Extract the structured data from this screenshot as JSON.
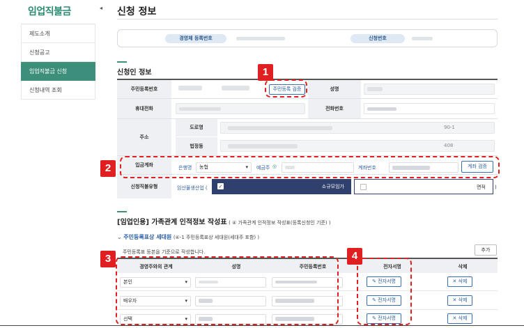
{
  "sidebar": {
    "title": "임업직불금",
    "collapse_icon": "◂",
    "items": [
      {
        "label": "제도소개",
        "active": false
      },
      {
        "label": "신청공고",
        "active": false
      },
      {
        "label": "임업직불금 신청",
        "active": true
      },
      {
        "label": "신청내역 조회",
        "active": false
      }
    ]
  },
  "header": {
    "title": "신청 정보",
    "business_reg_label": "경영체 등록번호",
    "application_no_label": "신청번호"
  },
  "applicant": {
    "section_title": "신청인 정보",
    "resident_no_label": "주민등록번호",
    "verify_button": "주민등록 검증",
    "name_label": "성명",
    "mobile_label": "휴대전화",
    "phone_label": "전화번호",
    "address_label": "주소",
    "road_label": "도로명",
    "road_suffix": "90-1",
    "legal_dong_label": "법정동",
    "legal_dong_suffix": "408",
    "account_label": "입금계좌",
    "bank_label": "은행명",
    "bank_value": "농협",
    "holder_label": "예금주",
    "account_no_label": "계좌번호",
    "account_verify_button": "계좌 검증",
    "payment_type_label": "신청직불유형",
    "forestry_label": "임산물생산업 (",
    "small_scale_label": "소규모임가",
    "area_label": "면적",
    "close_paren": ")"
  },
  "family": {
    "section_title": "[임업인용] 가족관계 인적정보 작성표",
    "section_sub": "( ④ 가족관계 인적정보 작성표(등록신청인 기준) )",
    "sub_title": "주민등록표상 세대원",
    "sub_note": "(④-1 주민등록표상 세대원(세대주 포함) )",
    "basis_note": "주민등록표 등본을 기준으로 작성합니다.",
    "add_button": "추가",
    "columns": [
      "경영주와의 관계",
      "성명",
      "주민등록번호",
      "전자서명",
      "삭제"
    ],
    "rows": [
      {
        "relation": "본인",
        "sign": "전자서명",
        "delete": "삭제"
      },
      {
        "relation": "배우자",
        "sign": "전자서명",
        "delete": "삭제"
      },
      {
        "relation": "선택",
        "sign": "전자서명",
        "delete": "삭제"
      }
    ]
  },
  "annotations": [
    "1",
    "2",
    "3",
    "4"
  ],
  "icons": {
    "select_arrow": "▾",
    "pen": "✎",
    "x_mark": "✕",
    "check": "✓",
    "chevron": "⌄"
  }
}
